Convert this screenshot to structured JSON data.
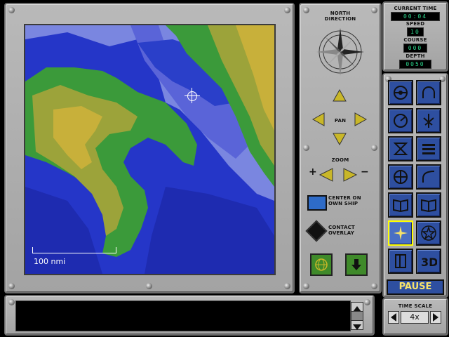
{
  "status": {
    "current_time_label": "CURRENT TIME",
    "current_time": "00:04",
    "speed_label": "SPEED",
    "speed": "10",
    "course_label": "COURSE",
    "course": "000",
    "depth_label": "DEPTH",
    "depth": "0050"
  },
  "nav": {
    "north_label": "NORTH",
    "direction_label": "DIRECTION",
    "pan_label": "PAN",
    "zoom_label": "ZOOM",
    "zoom_in": "+",
    "zoom_out": "−",
    "center_label_1": "CENTER ON",
    "center_label_2": "OWN SHIP",
    "contact_label_1": "CONTACT",
    "contact_label_2": "OVERLAY"
  },
  "map": {
    "scale_text": "100 nmi"
  },
  "controls": {
    "pause_label": "PAUSE",
    "time_scale_label": "TIME SCALE",
    "time_scale_value": "4x"
  },
  "icons": [
    "helm-icon",
    "sonar-icon",
    "gauge-icon",
    "torpedo-icon",
    "tma-icon",
    "menu-icon",
    "periscope-icon",
    "ship-control-icon",
    "book-icon",
    "book-icon",
    "compass-nsew-icon",
    "star-icon",
    "door-icon",
    "3d-icon"
  ],
  "colors": {
    "panel": "#b0b0b0",
    "button": "#2e4fa0",
    "pause_text": "#f7e36a",
    "readout": "#2bd38a"
  }
}
